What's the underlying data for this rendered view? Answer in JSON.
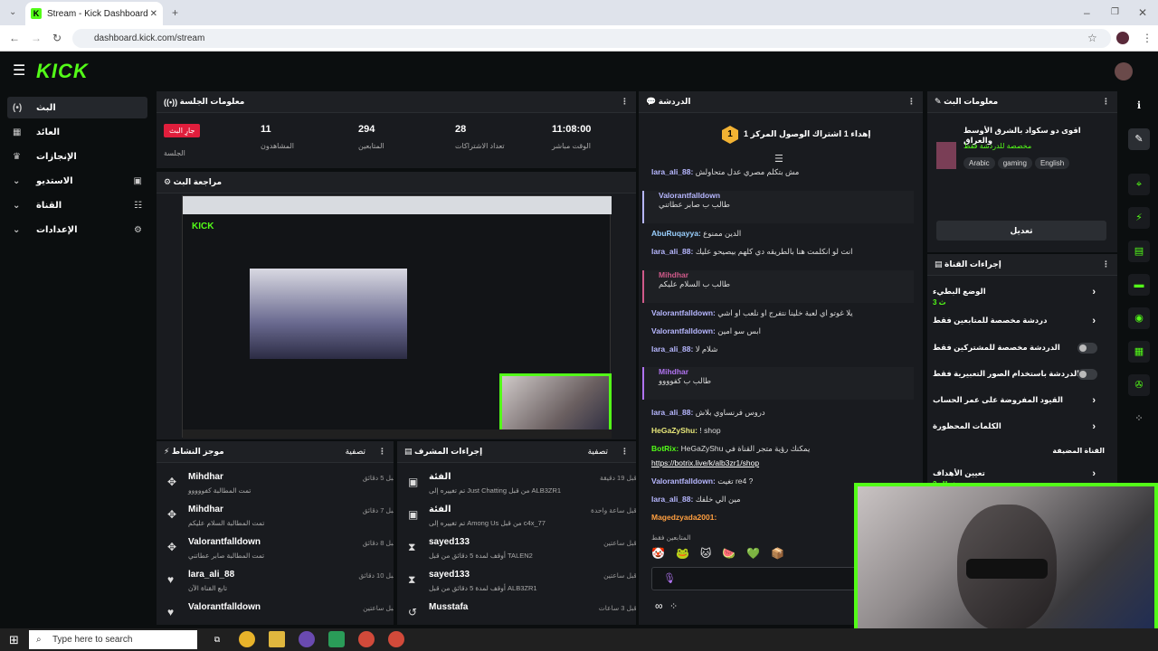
{
  "browser": {
    "tab_title": "Stream - Kick Dashboard",
    "url": "dashboard.kick.com/stream"
  },
  "logo": "KICK",
  "sidebar": [
    {
      "label": "البث",
      "icon": "(•)"
    },
    {
      "label": "العائد",
      "icon": "▦"
    },
    {
      "label": "الإنجازات",
      "icon": "🏆"
    },
    {
      "label": "الاستديو",
      "icon": "⌄"
    },
    {
      "label": "القناة",
      "icon": "⌄"
    },
    {
      "label": "الإعدادات",
      "icon": "⌄"
    }
  ],
  "session": {
    "title": "معلومات الجلسة",
    "badge": "جارِ البث",
    "stats": [
      {
        "label": "الجلسة",
        "value": ""
      },
      {
        "label": "المشاهدون",
        "value": "11"
      },
      {
        "label": "المتابعين",
        "value": "294"
      },
      {
        "label": "تعداد الاشتراكات",
        "value": "28"
      },
      {
        "label": "الوقت مباشر",
        "value": "11:08:00"
      }
    ]
  },
  "preview": {
    "title": "مراجعة البث"
  },
  "chat": {
    "title": "الدردشة",
    "pinned": "إهداء 1 اشتراك الوصول المركز 1",
    "pinned_rank": "1",
    "lines": [
      {
        "user": "lara_ali_88:",
        "text": "مش بتكلم مصري عدل متحاولش",
        "ucolor": "#b7b7ff"
      },
      {
        "user": "Valorantfalldown",
        "text": "طالب ب صابر عطاتني",
        "ucolor": "#b7b7ff",
        "reply": true
      },
      {
        "user": "AbuRuqayya:",
        "text": "الدين ممنوع",
        "ucolor": "#9ad0ff"
      },
      {
        "user": "lara_ali_88:",
        "text": "انت لو انكلمت هنا بالطريقه دي كلهم بيصيحو عليك",
        "ucolor": "#b7b7ff"
      },
      {
        "user": "Mihdhar",
        "text": "طالب ب السلام عليكم",
        "ucolor": "#d05a8a",
        "reply": true
      },
      {
        "user": "Valorantfalldown:",
        "text": "يلا غوتو اي لعبة خلينا نتفرج او نلعب او اشي",
        "ucolor": "#b7b7ff"
      },
      {
        "user": "Valorantfalldown:",
        "text": "ابس سو امين",
        "ucolor": "#b7b7ff"
      },
      {
        "user": "lara_ali_88:",
        "text": "شلام لا",
        "ucolor": "#b7b7ff"
      },
      {
        "user": "Mihdhar",
        "text": "طالب ب كفوووو",
        "ucolor": "#b073f0",
        "reply": true
      },
      {
        "user": "lara_ali_88:",
        "text": "دروس فرنساوي بلاش",
        "ucolor": "#b7b7ff"
      },
      {
        "user": "HeGaZyShu:",
        "text": "! shop",
        "ucolor": "#e8e87a"
      },
      {
        "user": "BotRix:",
        "text": "HeGaZyShu يمكنك رؤية متجر القناة في",
        "ucolor": "#53fc18"
      },
      {
        "user": "",
        "text": "https://botrix.live/k/alb3zr1/shop",
        "ucolor": "#fff",
        "link": true
      },
      {
        "user": "Valorantfalldown:",
        "text": "تغيت re4 ?",
        "ucolor": "#b7b7ff"
      },
      {
        "user": "lara_ali_88:",
        "text": "مين الي خلفك",
        "ucolor": "#b7b7ff"
      },
      {
        "user": "Magedzyada2001:",
        "text": "",
        "ucolor": "#ff9f40"
      }
    ],
    "followers_only": "المتابعين فقط"
  },
  "streaminfo": {
    "title": "معلومات البث",
    "stream_title": "اقوى دو سكواد بالشرق الأوسط والعراق",
    "sub": "مخصصة للدردشة فقط",
    "tags": [
      "Arabic",
      "gaming",
      "English"
    ],
    "edit": "تعديل"
  },
  "controls": {
    "title": "إجراءات القناة",
    "rows": [
      {
        "label": "الوضع البطيء",
        "sub": "3 ث",
        "type": "chev"
      },
      {
        "label": "دردشة مخصصة للمتابعين فقط",
        "type": "chev"
      },
      {
        "label": "الدردشة مخصصة للمشتركين فقط",
        "type": "toggle"
      },
      {
        "label": "الدردشة باستخدام الصور التعبيرية فقط",
        "type": "toggle"
      },
      {
        "label": "القيود المفروضة على عمر الحساب",
        "type": "chev"
      },
      {
        "label": "الكلمات المحظورة",
        "type": "chev"
      },
      {
        "label": "القناة المضيفة",
        "type": "none"
      },
      {
        "label": "تعيين الأهداف",
        "sub": "فعال 2",
        "type": "chev"
      }
    ]
  },
  "activity": {
    "title": "موجز النشاط",
    "filter": "تصفية",
    "items": [
      {
        "name": "Mihdhar",
        "sub": "تمت المطالبة كفووووو",
        "time": "قبل 5 دقائق",
        "icon": "✥"
      },
      {
        "name": "Mihdhar",
        "sub": "تمت المطالبة السلام عليكم",
        "time": "قبل 7 دقائق",
        "icon": "✥"
      },
      {
        "name": "Valorantfalldown",
        "sub": "تمت المطالبة صابر عطاتني",
        "time": "قبل 8 دقائق",
        "icon": "✥"
      },
      {
        "name": "lara_ali_88",
        "sub": "تابع القناة الآن",
        "time": "قبل 10 دقائق",
        "icon": "♥"
      },
      {
        "name": "Valorantfalldown",
        "sub": "",
        "time": "قبل ساعتين",
        "icon": "♥"
      }
    ]
  },
  "modactions": {
    "title": "إجراءات المشرف",
    "filter": "تصفية",
    "items": [
      {
        "name": "الفئة",
        "sub": "تم تغييره إلى Just Chatting من قبل ALB3ZR1",
        "time": "قبل 19 دقيقة",
        "icon": "▣"
      },
      {
        "name": "الفئة",
        "sub": "تم تغييره إلى Among Us من قبل c4x_77",
        "time": "قبل ساعة واحدة",
        "icon": "▣"
      },
      {
        "name": "sayed133",
        "sub": "أوقف لمدة 5 دقائق من قبل TALEN2",
        "time": "قبل ساعتين",
        "icon": "⧗"
      },
      {
        "name": "sayed133",
        "sub": "أوقف لمدة 5 دقائق من قبل ALB3ZR1",
        "time": "قبل ساعتين",
        "icon": "⧗"
      },
      {
        "name": "Musstafa",
        "sub": "",
        "time": "قبل 3 ساعات",
        "icon": "↺"
      }
    ]
  },
  "taskbar": {
    "search_placeholder": "Type here to search"
  },
  "colors": {
    "brand": "#53fc18",
    "bg": "#0b0e0f",
    "panel": "#191b1f"
  }
}
